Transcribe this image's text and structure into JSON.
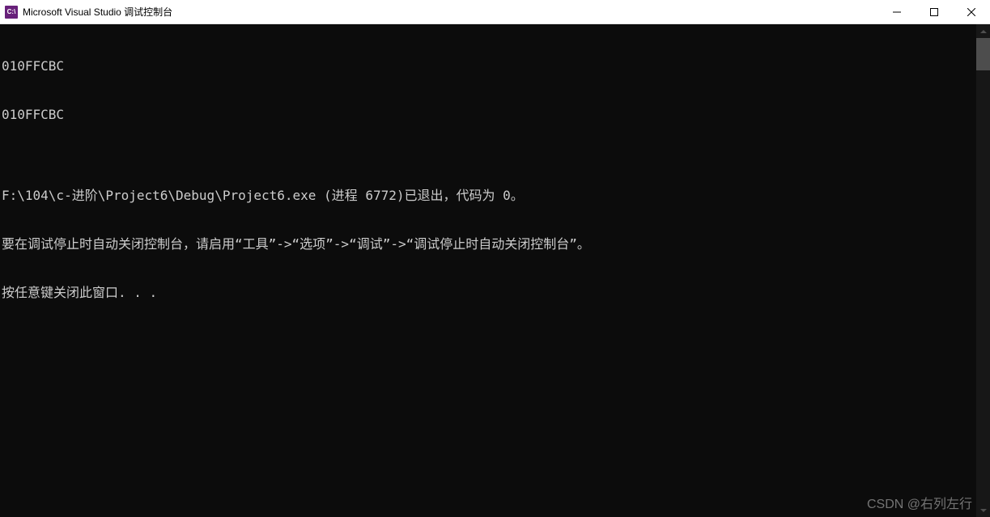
{
  "titlebar": {
    "icon_text": "C:\\",
    "title": "Microsoft Visual Studio 调试控制台"
  },
  "console": {
    "lines": [
      "010FFCBC",
      "010FFCBC",
      "",
      "F:\\104\\c-进阶\\Project6\\Debug\\Project6.exe (进程 6772)已退出，代码为 0。",
      "要在调试停止时自动关闭控制台，请启用“工具”->“选项”->“调试”->“调试停止时自动关闭控制台”。",
      "按任意键关闭此窗口. . ."
    ]
  },
  "watermark": "CSDN @右列左行"
}
